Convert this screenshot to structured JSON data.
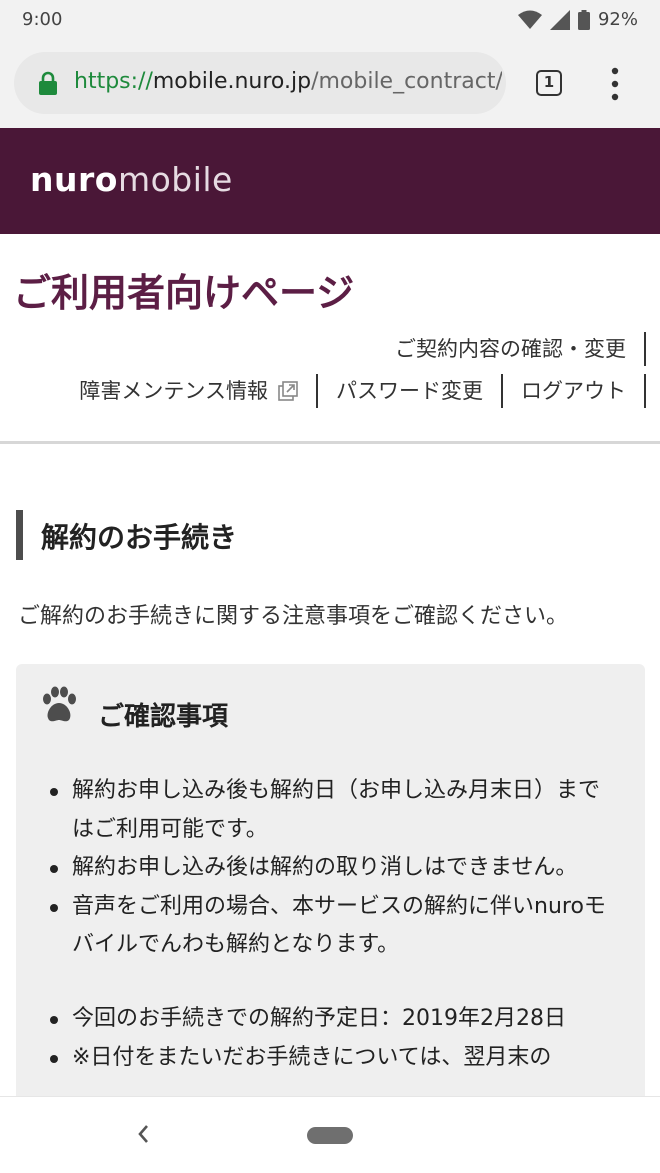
{
  "status_bar": {
    "time": "9:00",
    "battery_level": "92%"
  },
  "browser": {
    "url_scheme": "https://",
    "url_host": "mobile.nuro.jp",
    "url_path": "/mobile_contract/u",
    "tab_count": "1"
  },
  "site": {
    "logo_bold": "nuro",
    "logo_light": "mobile"
  },
  "page": {
    "title": "ご利用者向けページ"
  },
  "nav": {
    "contract": "ご契約内容の確認・変更",
    "maintenance": "障害メンテンス情報",
    "password": "パスワード変更",
    "logout": "ログアウト"
  },
  "section": {
    "heading": "解約のお手続き",
    "intro": "ご解約のお手続きに関する注意事項をご確認ください。"
  },
  "notice": {
    "title": "ご確認事項",
    "items": [
      "解約お申し込み後も解約日（お申し込み月末日）まではご利用可能です。",
      "解約お申し込み後は解約の取り消しはできません。",
      "音声をご利用の場合、本サービスの解約に伴いnuroモバイルでんわも解約となります。"
    ],
    "items2": [
      "今回のお手続きでの解約予定日：2019年2月28日",
      "※日付をまたいだお手続きについては、翌月末の"
    ]
  },
  "colors": {
    "brand": "#4a1737",
    "title": "#5c1e45",
    "secure": "#1e8a3c"
  }
}
